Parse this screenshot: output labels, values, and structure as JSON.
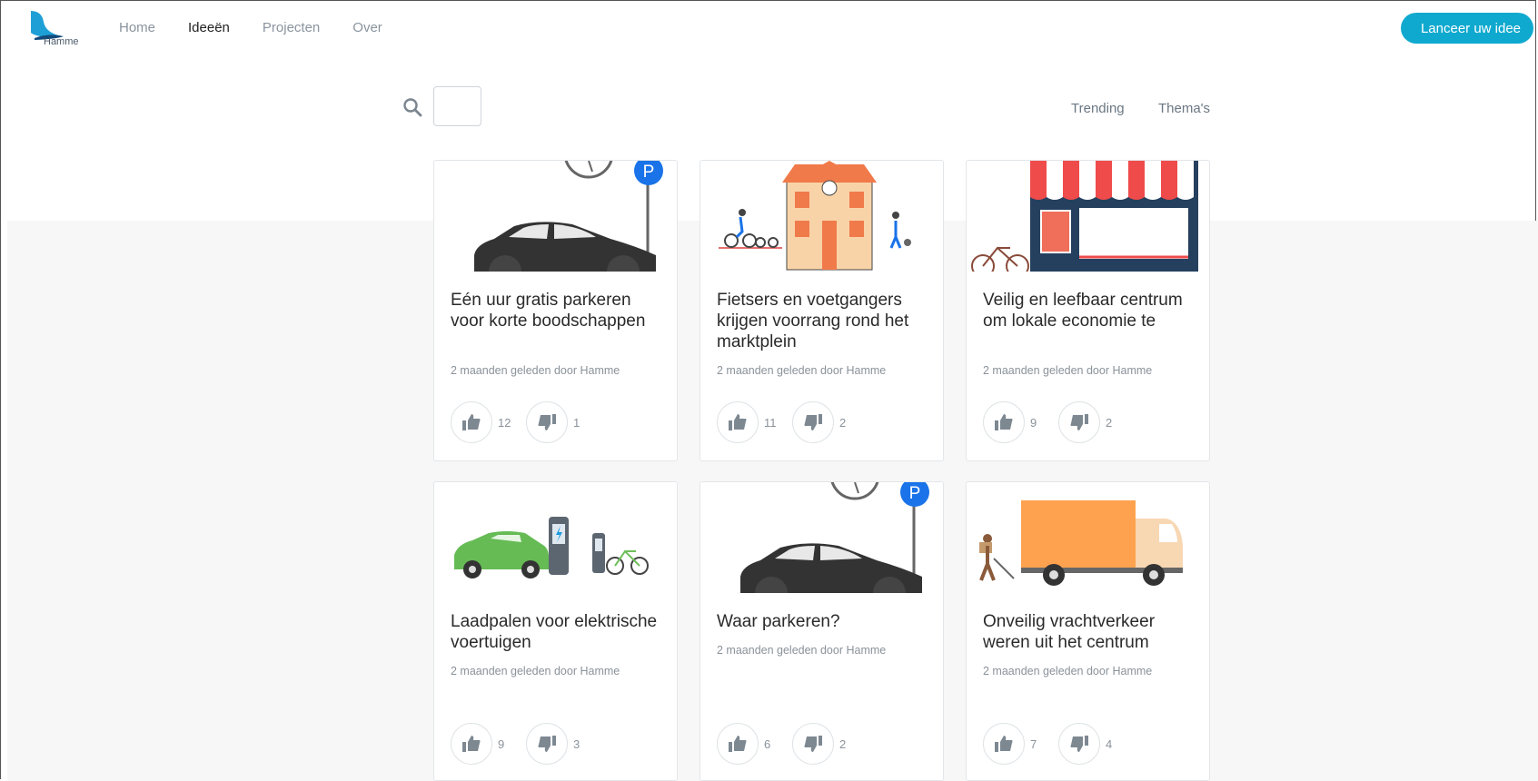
{
  "header": {
    "logo_text": "Hamme",
    "nav": [
      {
        "label": "Home",
        "active": false
      },
      {
        "label": "Ideeën",
        "active": true
      },
      {
        "label": "Projecten",
        "active": false
      },
      {
        "label": "Over",
        "active": false
      }
    ],
    "cta_label": "Lanceer uw idee"
  },
  "toolbar": {
    "search_icon": "search-icon",
    "search_value": "",
    "filters": [
      "Trending",
      "Thema's"
    ]
  },
  "cards": [
    {
      "title": "Eén uur gratis parkeren voor korte boodschappen",
      "meta": "2 maanden geleden door Hamme",
      "upvotes": "12",
      "downvotes": "1",
      "image": "parked-car-illustration"
    },
    {
      "title": "Fietsers en voetgangers krijgen voorrang rond het marktplein",
      "meta": "2 maanden geleden door Hamme",
      "upvotes": "11",
      "downvotes": "2",
      "image": "market-square-illustration"
    },
    {
      "title": "Veilig en leefbaar centrum om lokale economie te",
      "meta": "2 maanden geleden door Hamme",
      "upvotes": "9",
      "downvotes": "2",
      "image": "shopfront-illustration"
    },
    {
      "title": "Laadpalen voor elektrische voertuigen",
      "meta": "2 maanden geleden door Hamme",
      "upvotes": "9",
      "downvotes": "3",
      "image": "charging-station-illustration"
    },
    {
      "title": "Waar parkeren?",
      "meta": "2 maanden geleden door Hamme",
      "upvotes": "6",
      "downvotes": "2",
      "image": "parked-car-illustration"
    },
    {
      "title": "Onveilig vrachtverkeer weren uit het centrum",
      "meta": "2 maanden geleden door Hamme",
      "upvotes": "7",
      "downvotes": "4",
      "image": "truck-illustration"
    }
  ],
  "colors": {
    "accent": "#0fa9cf",
    "parking_blue": "#1a73e8"
  }
}
